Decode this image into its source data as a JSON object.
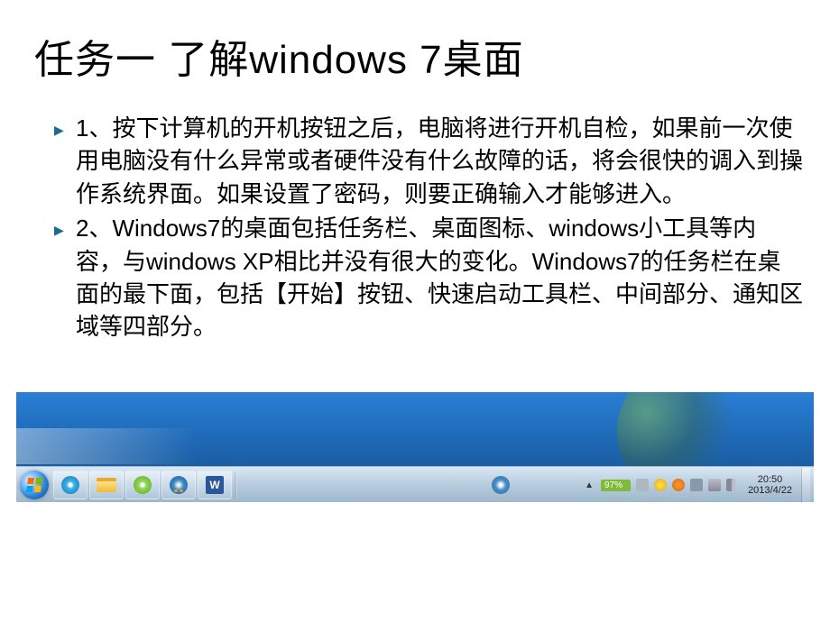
{
  "title": "任务一 了解windows 7桌面",
  "bullets": [
    "1、按下计算机的开机按钮之后，电脑将进行开机自检，如果前一次使用电脑没有什么异常或者硬件没有什么故障的话，将会很快的调入到操作系统界面。如果设置了密码，则要正确输入才能够进入。",
    "2、Windows7的桌面包括任务栏、桌面图标、windows小工具等内容，与windows XP相比并没有很大的变化。Windows7的任务栏在桌面的最下面，包括【开始】按钮、快速启动工具栏、中间部分、通知区域等四部分。"
  ],
  "taskbar": {
    "word_letter": "W",
    "battery_pct": "97%",
    "clock_time": "20:50",
    "clock_date": "2013/4/22"
  }
}
